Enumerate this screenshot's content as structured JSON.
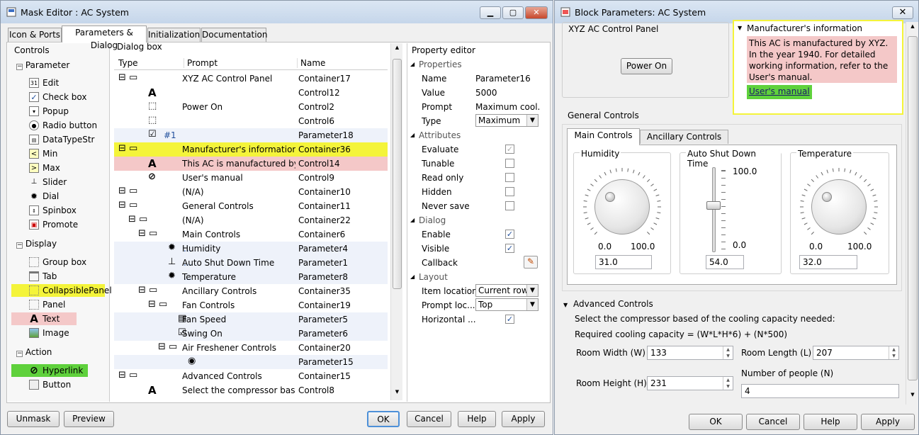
{
  "mask_editor": {
    "title": "Mask Editor : AC System",
    "tabs": [
      "Icon & Ports",
      "Parameters & Dialog",
      "Initialization",
      "Documentation"
    ],
    "controls": {
      "header": "Controls",
      "parameter_header": "Parameter",
      "parameter_items": [
        "Edit",
        "Check box",
        "Popup",
        "Radio button",
        "DataTypeStr",
        "Min",
        "Max",
        "Slider",
        "Dial",
        "Spinbox",
        "Promote"
      ],
      "display_header": "Display",
      "display_items": [
        "Group box",
        "Tab",
        "CollapsiblePanel",
        "Panel",
        "Text",
        "Image"
      ],
      "action_header": "Action",
      "action_items": [
        "Hyperlink",
        "Button"
      ]
    },
    "dialog_box": {
      "header": "Dialog box",
      "columns": [
        "Type",
        "Prompt",
        "Name"
      ],
      "rows": [
        {
          "type": "",
          "prompt": "XYZ AC Control Panel",
          "name": "Container17"
        },
        {
          "type": "",
          "prompt": "",
          "name": "Control12"
        },
        {
          "type": "",
          "prompt": "Power On",
          "name": "Control2"
        },
        {
          "type": "",
          "prompt": "",
          "name": "Control6"
        },
        {
          "type": "#1",
          "prompt": "",
          "name": "Parameter18"
        },
        {
          "type": "",
          "prompt": "Manufacturer's information",
          "name": "Container36"
        },
        {
          "type": "",
          "prompt": "This AC is manufactured by ...",
          "name": "Control14"
        },
        {
          "type": "",
          "prompt": "User's manual",
          "name": "Control9"
        },
        {
          "type": "",
          "prompt": "(N/A)",
          "name": "Container10"
        },
        {
          "type": "",
          "prompt": "General Controls",
          "name": "Container11"
        },
        {
          "type": "",
          "prompt": "(N/A)",
          "name": "Container22"
        },
        {
          "type": "",
          "prompt": "Main Controls",
          "name": "Container6"
        },
        {
          "type": "...",
          "prompt": "Humidity",
          "name": "Parameter4"
        },
        {
          "type": "...",
          "prompt": "Auto Shut Down Time",
          "name": "Parameter1"
        },
        {
          "type": "...",
          "prompt": "Temperature",
          "name": "Parameter8"
        },
        {
          "type": "",
          "prompt": "Ancillary Controls",
          "name": "Container35"
        },
        {
          "type": "",
          "prompt": "Fan Controls",
          "name": "Container19"
        },
        {
          "type": "",
          "prompt": "Fan Speed",
          "name": "Parameter5"
        },
        {
          "type": "",
          "prompt": "Swing On",
          "name": "Parameter6"
        },
        {
          "type": "",
          "prompt": "Air Freshener Controls",
          "name": "Container20"
        },
        {
          "type": "",
          "prompt": "",
          "name": "Parameter15"
        },
        {
          "type": "",
          "prompt": "Advanced Controls",
          "name": "Container15"
        },
        {
          "type": "",
          "prompt": "Select the compressor based ...",
          "name": "Control8"
        }
      ]
    },
    "property_editor": {
      "header": "Property editor",
      "properties_header": "Properties",
      "name_label": "Name",
      "name_value": "Parameter16",
      "value_label": "Value",
      "value_value": "5000",
      "prompt_label": "Prompt",
      "prompt_value": "Maximum cool...",
      "type_label": "Type",
      "type_value": "Maximum",
      "attributes_header": "Attributes",
      "attributes": [
        {
          "label": "Evaluate",
          "checked": true,
          "disabled": true
        },
        {
          "label": "Tunable",
          "checked": false
        },
        {
          "label": "Read only",
          "checked": false
        },
        {
          "label": "Hidden",
          "checked": false
        },
        {
          "label": "Never save",
          "checked": false
        }
      ],
      "dialog_header": "Dialog",
      "dialog_items": [
        {
          "label": "Enable",
          "checked": true
        },
        {
          "label": "Visible",
          "checked": true
        }
      ],
      "callback_label": "Callback",
      "layout_header": "Layout",
      "item_location_label": "Item location",
      "item_location_value": "Current row",
      "prompt_location_label": "Prompt loc...",
      "prompt_location_value": "Top",
      "horizontal_label": "Horizontal ...",
      "horizontal_checked": true
    },
    "buttons": {
      "unmask": "Unmask",
      "preview": "Preview",
      "ok": "OK",
      "cancel": "Cancel",
      "help": "Help",
      "apply": "Apply"
    }
  },
  "block_params": {
    "title": "Block Parameters: AC System",
    "control_panel_title": "XYZ AC Control Panel",
    "power_button": "Power On",
    "manufacturer_title": "Manufacturer's information",
    "manufacturer_text": "This AC is manufactured by XYZ. In the year 1940. For detailed working information, refer to the User's manual.",
    "manual_link": "User's manual",
    "general_controls": "General Controls",
    "tabs": [
      "Main Controls",
      "Ancillary Controls"
    ],
    "humidity": {
      "label": "Humidity",
      "min": "0.0",
      "max": "100.0",
      "value": "31.0"
    },
    "shutdown": {
      "label": "Auto Shut Down Time",
      "max": "100.0",
      "min": "0.0",
      "value": "54.0"
    },
    "temperature": {
      "label": "Temperature",
      "min": "0.0",
      "max": "100.0",
      "value": "32.0"
    },
    "advanced_title": "Advanced Controls",
    "advanced_text1": "Select the compressor based of the cooling capacity needed:",
    "advanced_text2": "Required cooling capacity = (W*L*H*6) + (N*500)",
    "room_width": {
      "label": "Room Width (W)",
      "value": "133"
    },
    "room_length": {
      "label": "Room Length (L)",
      "value": "207"
    },
    "room_height": {
      "label": "Room Height (H)",
      "value": "231"
    },
    "people": {
      "label": "Number of people (N)",
      "value": "4"
    },
    "buttons": {
      "ok": "OK",
      "cancel": "Cancel",
      "help": "Help",
      "apply": "Apply"
    }
  },
  "colors": {
    "highlight_yellow": "#f4f43a",
    "highlight_pink": "#f4c8c8",
    "highlight_green": "#5fd13c",
    "accent_blue": "#1f4e9c"
  }
}
